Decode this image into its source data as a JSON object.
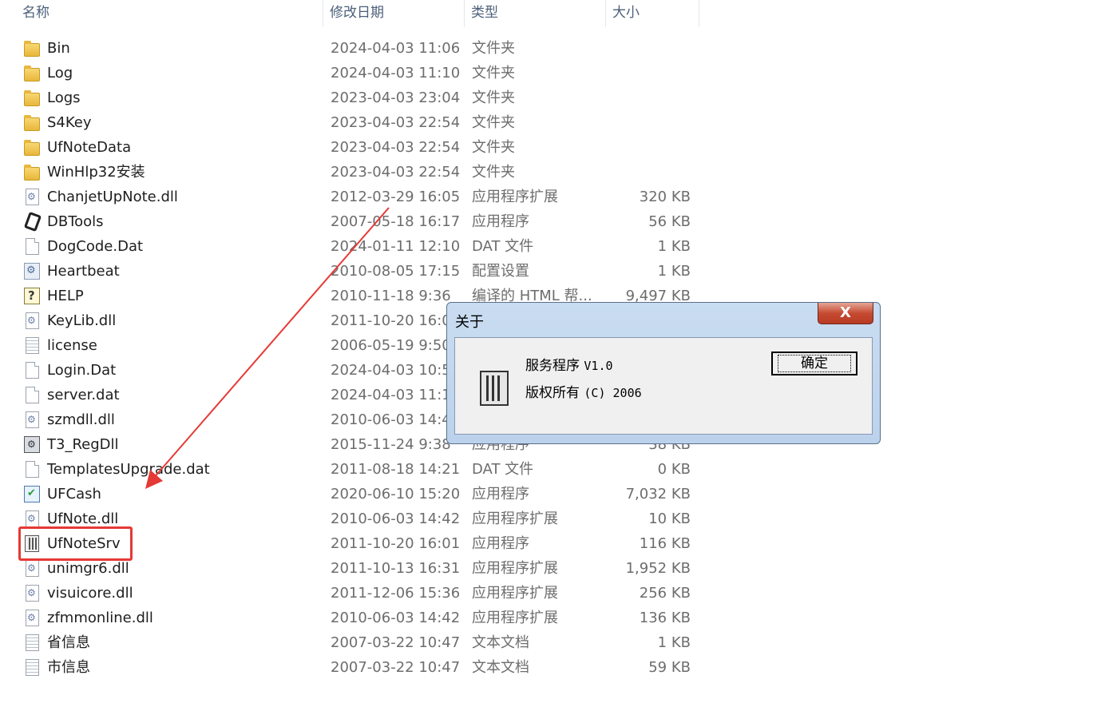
{
  "columns": {
    "name": "名称",
    "date": "修改日期",
    "type": "类型",
    "size": "大小"
  },
  "files": [
    {
      "name": "Bin",
      "date": "2024-04-03 11:06",
      "type": "文件夹",
      "size": "",
      "icon": "folder-icon"
    },
    {
      "name": "Log",
      "date": "2024-04-03 11:10",
      "type": "文件夹",
      "size": "",
      "icon": "folder-icon"
    },
    {
      "name": "Logs",
      "date": "2023-04-03 23:04",
      "type": "文件夹",
      "size": "",
      "icon": "folder-icon"
    },
    {
      "name": "S4Key",
      "date": "2023-04-03 22:54",
      "type": "文件夹",
      "size": "",
      "icon": "folder-icon"
    },
    {
      "name": "UfNoteData",
      "date": "2023-04-03 22:54",
      "type": "文件夹",
      "size": "",
      "icon": "folder-icon"
    },
    {
      "name": "WinHlp32安装",
      "date": "2023-04-03 22:54",
      "type": "文件夹",
      "size": "",
      "icon": "folder-icon"
    },
    {
      "name": "ChanjetUpNote.dll",
      "date": "2012-03-29 16:05",
      "type": "应用程序扩展",
      "size": "320 KB",
      "icon": "dll-icon"
    },
    {
      "name": "DBTools",
      "date": "2007-05-18 16:17",
      "type": "应用程序",
      "size": "56 KB",
      "icon": "tool-icon"
    },
    {
      "name": "DogCode.Dat",
      "date": "2024-01-11 12:10",
      "type": "DAT 文件",
      "size": "1 KB",
      "icon": "file-icon"
    },
    {
      "name": "Heartbeat",
      "date": "2010-08-05 17:15",
      "type": "配置设置",
      "size": "1 KB",
      "icon": "config-icon"
    },
    {
      "name": "HELP",
      "date": "2010-11-18 9:36",
      "type": "编译的 HTML 帮...",
      "size": "9,497 KB",
      "icon": "help-icon"
    },
    {
      "name": "KeyLib.dll",
      "date": "2011-10-20 16:01",
      "type": "",
      "size": "",
      "icon": "dll-icon"
    },
    {
      "name": "license",
      "date": "2006-05-19 9:50",
      "type": "",
      "size": "",
      "icon": "text-icon"
    },
    {
      "name": "Login.Dat",
      "date": "2024-04-03 10:58",
      "type": "",
      "size": "",
      "icon": "file-icon"
    },
    {
      "name": "server.dat",
      "date": "2024-04-03 11:10",
      "type": "",
      "size": "",
      "icon": "file-icon"
    },
    {
      "name": "szmdll.dll",
      "date": "2010-06-03 14:42",
      "type": "",
      "size": "",
      "icon": "dll-icon"
    },
    {
      "name": "T3_RegDll",
      "date": "2015-11-24 9:38",
      "type": "应用程序",
      "size": "38 KB",
      "icon": "register-icon"
    },
    {
      "name": "TemplatesUpgrade.dat",
      "date": "2011-08-18 14:21",
      "type": "DAT 文件",
      "size": "0 KB",
      "icon": "file-icon"
    },
    {
      "name": "UFCash",
      "date": "2020-06-10 15:20",
      "type": "应用程序",
      "size": "7,032 KB",
      "icon": "cash-icon"
    },
    {
      "name": "UfNote.dll",
      "date": "2010-06-03 14:42",
      "type": "应用程序扩展",
      "size": "10 KB",
      "icon": "dll-icon"
    },
    {
      "name": "UfNoteSrv",
      "date": "2011-10-20 16:01",
      "type": "应用程序",
      "size": "116 KB",
      "icon": "server-app-icon"
    },
    {
      "name": "unimgr6.dll",
      "date": "2011-10-13 16:31",
      "type": "应用程序扩展",
      "size": "1,952 KB",
      "icon": "dll-icon"
    },
    {
      "name": "visuicore.dll",
      "date": "2011-12-06 15:36",
      "type": "应用程序扩展",
      "size": "256 KB",
      "icon": "dll-icon"
    },
    {
      "name": "zfmmonline.dll",
      "date": "2010-06-03 14:42",
      "type": "应用程序扩展",
      "size": "136 KB",
      "icon": "dll-icon"
    },
    {
      "name": "省信息",
      "date": "2007-03-22 10:47",
      "type": "文本文档",
      "size": "1 KB",
      "icon": "text-icon"
    },
    {
      "name": "市信息",
      "date": "2007-03-22 10:47",
      "type": "文本文档",
      "size": "59 KB",
      "icon": "text-icon"
    }
  ],
  "dialog": {
    "title": "关于",
    "close_label": "X",
    "line1_text": "服务程序",
    "line1_version": "V1.0",
    "line2_text": "版权所有",
    "line2_copyright": "(C) 2006",
    "ok_label": "确定"
  },
  "annotation_colors": {
    "highlight": "#e53935",
    "arrow": "#e53935"
  }
}
